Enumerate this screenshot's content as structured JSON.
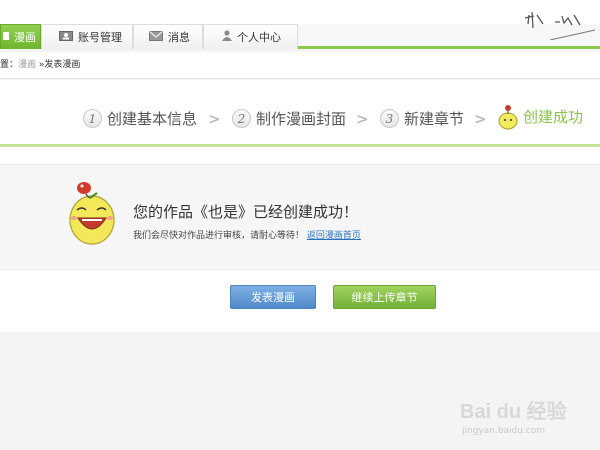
{
  "tabs": [
    {
      "label": "漫画",
      "icon": "comic-icon"
    },
    {
      "label": "账号管理",
      "icon": "account-card-icon"
    },
    {
      "label": "消息",
      "icon": "envelope-icon"
    },
    {
      "label": "个人中心",
      "icon": "person-icon"
    }
  ],
  "breadcrumb": {
    "prefix": "置：",
    "link": "漫画",
    "separator": "»",
    "current": "发表漫画"
  },
  "steps": [
    {
      "num": "1",
      "label": "创建基本信息"
    },
    {
      "num": "2",
      "label": "制作漫画封面"
    },
    {
      "num": "3",
      "label": "新建章节"
    },
    {
      "num": "",
      "label": "创建成功"
    }
  ],
  "success": {
    "title": "您的作品《也是》已经创建成功！",
    "subtitle": "我们会尽快对作品进行审核，请耐心等待！",
    "back_link": "返回漫画首页"
  },
  "buttons": {
    "publish": "发表漫画",
    "continue": "继续上传章节"
  },
  "watermark": {
    "brand": "Bai du 经验",
    "url": "jingyan.baidu.com"
  },
  "colors": {
    "accent_green": "#8cc84b",
    "button_blue": "#5b95d3",
    "link_blue": "#2a70c2"
  }
}
